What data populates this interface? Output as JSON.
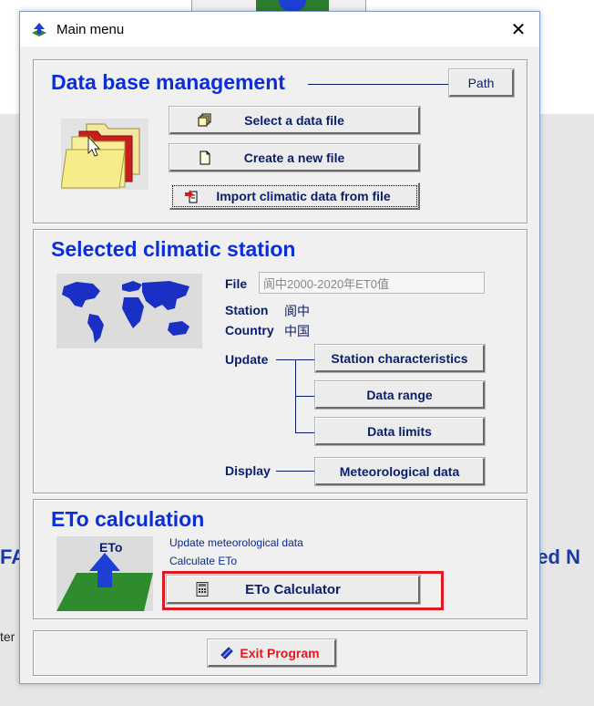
{
  "background": {
    "left_text_1": "FA",
    "right_text_1": "ted N",
    "left_text_2": "ter"
  },
  "window": {
    "title": "Main menu",
    "close_glyph": "✕"
  },
  "database": {
    "title": "Data base management",
    "path_button": "Path",
    "select_button": "Select a data file",
    "create_button": "Create a new file",
    "import_button": "Import climatic data from file"
  },
  "station": {
    "title": "Selected climatic station",
    "file_label": "File",
    "file_value": "阆中2000-2020年ET0值",
    "station_label": "Station",
    "station_value": "阆中",
    "country_label": "Country",
    "country_value": "中国",
    "update_label": "Update",
    "station_characteristics_button": "Station characteristics",
    "data_range_button": "Data range",
    "data_limits_button": "Data limits",
    "display_label": "Display",
    "meteorological_data_button": "Meteorological data"
  },
  "eto": {
    "title": "ETo calculation",
    "image_label": "ETo",
    "line1": "Update meteorological data",
    "line2": "Calculate ETo",
    "calculator_button": "ETo Calculator"
  },
  "exit": {
    "button": "Exit Program"
  },
  "colors": {
    "title_blue": "#0b2fd6",
    "label_navy": "#0a1f6b",
    "highlight_red": "#e0181f",
    "exit_red": "#e0181f"
  },
  "icons": {
    "app": "app-up-arrow-icon",
    "select": "files-stack-icon",
    "create": "new-file-icon",
    "import": "import-file-icon",
    "calculator": "calculator-icon",
    "exit": "exit-book-icon"
  }
}
